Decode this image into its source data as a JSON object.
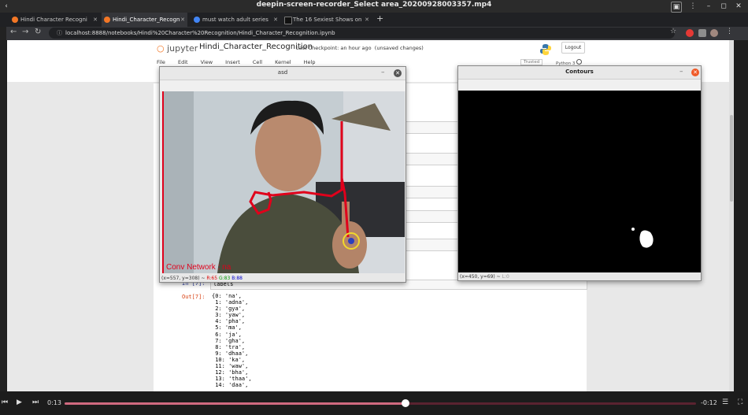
{
  "player": {
    "title": "deepin-screen-recorder_Select area_20200928003357.mp4",
    "elapsed": "0:13",
    "remaining": "-0:12",
    "progress": 0.54
  },
  "browser": {
    "tabs": [
      {
        "label": "Hindi Character Recogni",
        "icon": "jupyter-favicon",
        "active": false
      },
      {
        "label": "Hindi_Character_Recogn",
        "icon": "jupyter-favicon",
        "active": true
      },
      {
        "label": "must watch adult series",
        "icon": "google-favicon",
        "active": false
      },
      {
        "label": "The 16 Sexiest Shows on",
        "icon": "site-favicon",
        "active": false
      }
    ],
    "url": "localhost:8888/notebooks/Hindi%20Character%20Recognition/Hindi_Character_Recognition.ipynb"
  },
  "jupyter": {
    "logo_text": "jupyter",
    "notebook_title": "Hindi_Character_Recognition",
    "checkpoint": "Last Checkpoint: an hour ago",
    "unsaved": "(unsaved changes)",
    "logout": "Logout",
    "menu": [
      "File",
      "Edit",
      "View",
      "Insert",
      "Cell",
      "Kernel",
      "Help"
    ],
    "trusted": "Trusted",
    "kernel": "Python 3",
    "in_prompt": "In [7]:",
    "in_code": "labels",
    "out_prompt": "Out[7]:",
    "output_lines": [
      "{0: 'na',",
      " 1: 'adna',",
      " 2: 'gya',",
      " 3: 'yaw',",
      " 4: 'pha',",
      " 5: 'ma',",
      " 6: 'ja',",
      " 7: 'gha',",
      " 8: 'tra',",
      " 9: 'dhaa',",
      " 10: 'ka',",
      " 11: 'waw',",
      " 12: 'bha',",
      " 13: 'thaa',",
      " 14: 'daa',"
    ]
  },
  "asd_window": {
    "title": "asd",
    "overlay_text": "Conv Network :  na",
    "status_coords": "(x=557, y=308) ~",
    "status_r": "R:65",
    "status_g": "G:83",
    "status_b": "B:88"
  },
  "contours_window": {
    "title": "Contours",
    "status_coords": "(x=450, y=69) ~",
    "status_l": "L:0"
  },
  "colors": {
    "accent_jupyter": "#f37726",
    "track_played": "#d06a80",
    "drawing_red": "#e0001b",
    "pointer_ring": "#f2d82b"
  }
}
